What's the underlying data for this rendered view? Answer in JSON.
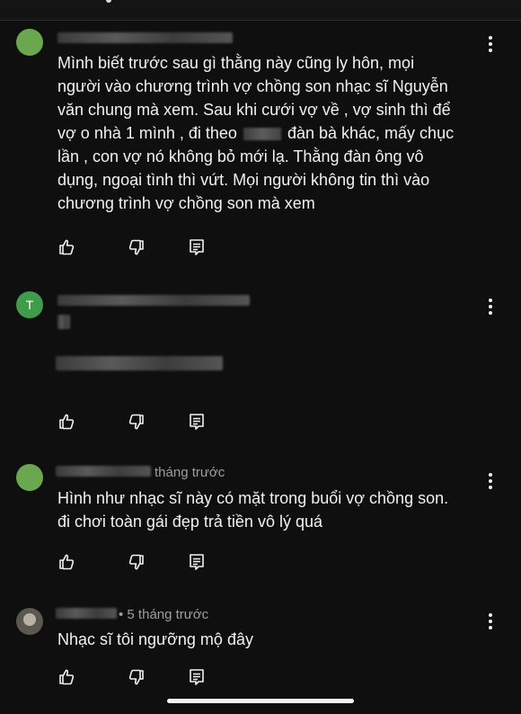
{
  "comments": [
    {
      "id": "c1",
      "time": "",
      "lines": [
        "Mình biết trước sau gì thằng này cũng ly hôn, mọi",
        "người vào chương trình vợ chồng son nhạc sĩ Nguyễn",
        "văn chung mà xem. Sau khi cưới vợ về , vợ sinh thì để",
        "vợ o nhà 1 mình , đi theo",
        "đàn bà khác, mấy chục",
        "lần , con vợ nó không bỏ mới lạ. Thằng đàn ông vô",
        "dụng, ngoại tình thì vứt. Mọi người không tin thì vào",
        "chương trình vợ chồng son mà xem"
      ]
    },
    {
      "id": "c2",
      "avatar_letter": "T",
      "time": "",
      "lines": []
    },
    {
      "id": "c3",
      "time": "tháng trước",
      "lines": [
        "Hình như nhạc sĩ này có mặt trong buổi vợ chồng son.",
        "đi chơi toàn gái đẹp trả tiền vô lý quá"
      ]
    },
    {
      "id": "c4",
      "time": "• 5 tháng trước",
      "lines": [
        "Nhạc sĩ tôi ngưỡng mộ đây"
      ]
    }
  ],
  "icons": {
    "like": "thumb-up-icon",
    "dislike": "thumb-down-icon",
    "reply": "reply-icon",
    "menu": "more-vert-icon"
  },
  "colors": {
    "background": "#0f0f0f",
    "text": "#f1f1f1",
    "meta": "#9e9e9e"
  }
}
